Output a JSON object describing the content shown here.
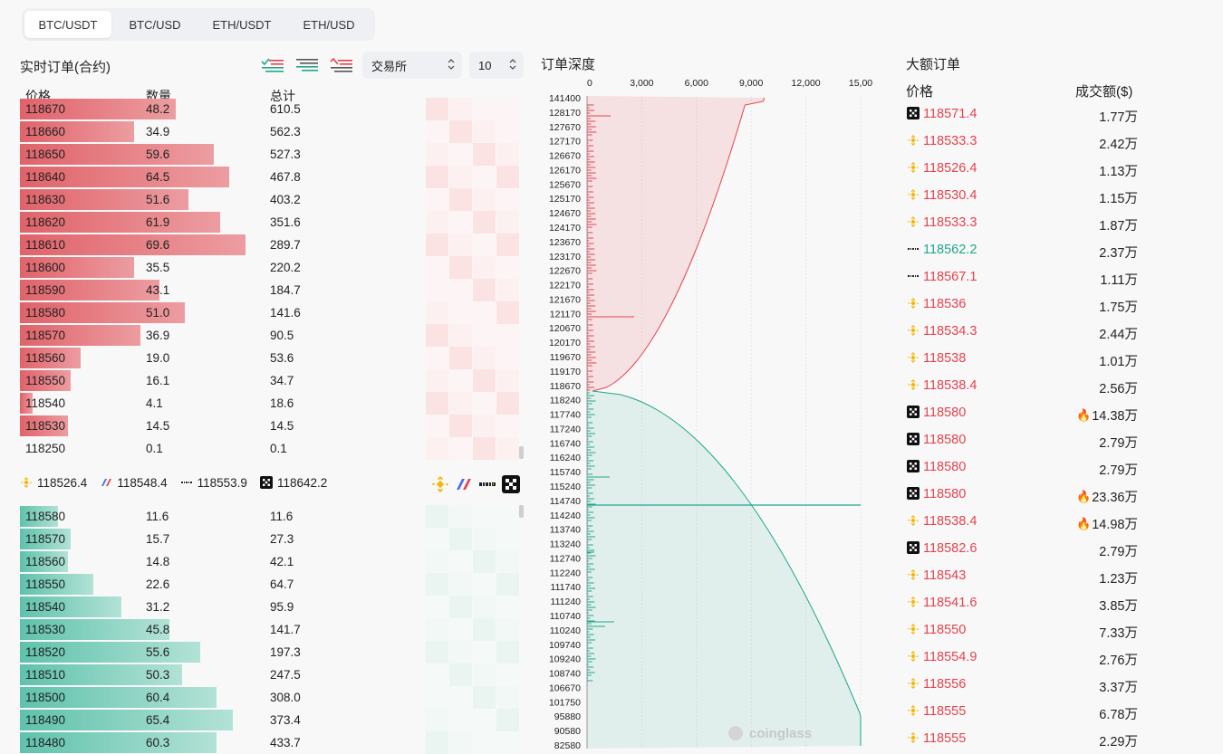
{
  "tabs": [
    "BTC/USDT",
    "BTC/USD",
    "ETH/USDT",
    "ETH/USD"
  ],
  "orderbook": {
    "title": "实时订单(合约)",
    "exchange_select": "交易所",
    "depth_select": "10",
    "headers": {
      "price": "价格",
      "qty": "数量",
      "total": "总计"
    },
    "asks": [
      {
        "price": "118670",
        "qty": "48.2",
        "total": "610.5",
        "fill": 0.49
      },
      {
        "price": "118660",
        "qty": "34.9",
        "total": "562.3",
        "fill": 0.36
      },
      {
        "price": "118650",
        "qty": "59.6",
        "total": "527.3",
        "fill": 0.61
      },
      {
        "price": "118640",
        "qty": "64.5",
        "total": "467.8",
        "fill": 0.66
      },
      {
        "price": "118630",
        "qty": "51.6",
        "total": "403.2",
        "fill": 0.53
      },
      {
        "price": "118620",
        "qty": "61.9",
        "total": "351.6",
        "fill": 0.63
      },
      {
        "price": "118610",
        "qty": "69.6",
        "total": "289.7",
        "fill": 0.71
      },
      {
        "price": "118600",
        "qty": "35.5",
        "total": "220.2",
        "fill": 0.36
      },
      {
        "price": "118590",
        "qty": "43.1",
        "total": "184.7",
        "fill": 0.44
      },
      {
        "price": "118580",
        "qty": "51.0",
        "total": "141.6",
        "fill": 0.52
      },
      {
        "price": "118570",
        "qty": "36.9",
        "total": "90.5",
        "fill": 0.38
      },
      {
        "price": "118560",
        "qty": "19.0",
        "total": "53.6",
        "fill": 0.19
      },
      {
        "price": "118550",
        "qty": "16.1",
        "total": "34.7",
        "fill": 0.16
      },
      {
        "price": "118540",
        "qty": "4.1",
        "total": "18.6",
        "fill": 0.04
      },
      {
        "price": "118530",
        "qty": "14.5",
        "total": "14.5",
        "fill": 0.15
      },
      {
        "price": "118250",
        "qty": "0.1",
        "total": "0.1",
        "fill": 0.0
      }
    ],
    "bids": [
      {
        "price": "118580",
        "qty": "11.6",
        "total": "11.6",
        "fill": 0.12
      },
      {
        "price": "118570",
        "qty": "15.7",
        "total": "27.3",
        "fill": 0.16
      },
      {
        "price": "118560",
        "qty": "14.8",
        "total": "42.1",
        "fill": 0.15
      },
      {
        "price": "118550",
        "qty": "22.6",
        "total": "64.7",
        "fill": 0.23
      },
      {
        "price": "118540",
        "qty": "31.2",
        "total": "95.9",
        "fill": 0.32
      },
      {
        "price": "118530",
        "qty": "45.8",
        "total": "141.7",
        "fill": 0.47
      },
      {
        "price": "118520",
        "qty": "55.6",
        "total": "197.3",
        "fill": 0.57
      },
      {
        "price": "118510",
        "qty": "50.3",
        "total": "247.5",
        "fill": 0.51
      },
      {
        "price": "118500",
        "qty": "60.4",
        "total": "308.0",
        "fill": 0.62
      },
      {
        "price": "118490",
        "qty": "65.4",
        "total": "373.4",
        "fill": 0.67
      },
      {
        "price": "118480",
        "qty": "60.3",
        "total": "433.7",
        "fill": 0.62
      }
    ],
    "exchange_prices": [
      {
        "exchange": "binance",
        "price": "118526.4"
      },
      {
        "exchange": "bitmex",
        "price": "118548.4"
      },
      {
        "exchange": "bybit",
        "price": "118553.9"
      },
      {
        "exchange": "okx",
        "price": "118642.2"
      }
    ]
  },
  "depth_chart": {
    "title": "订单深度",
    "x_ticks": [
      "0",
      "3,000",
      "6,000",
      "9,000",
      "12,000",
      "15,00"
    ],
    "y_ticks": [
      "141400",
      "128170",
      "127670",
      "127170",
      "126670",
      "126170",
      "125670",
      "125170",
      "124670",
      "124170",
      "123670",
      "123170",
      "122670",
      "122170",
      "121670",
      "121170",
      "120670",
      "120170",
      "119670",
      "119170",
      "118670",
      "118240",
      "117740",
      "117240",
      "116740",
      "116240",
      "115740",
      "115240",
      "114740",
      "114240",
      "113740",
      "113240",
      "112740",
      "112240",
      "111740",
      "111240",
      "110740",
      "110240",
      "109740",
      "109240",
      "108740",
      "106670",
      "101750",
      "95880",
      "90580",
      "82580"
    ],
    "watermark": "coinglass",
    "colors": {
      "ask": "#e5424e",
      "bid": "#1fa78a"
    }
  },
  "large_orders": {
    "title": "大额订单",
    "headers": {
      "price": "价格",
      "amount": "成交额($)"
    },
    "rows": [
      {
        "exchange": "okx",
        "price": "118571.4",
        "amount": "1.77万",
        "side": "sell",
        "hot": false
      },
      {
        "exchange": "binance",
        "price": "118533.3",
        "amount": "2.42万",
        "side": "sell",
        "hot": false
      },
      {
        "exchange": "binance",
        "price": "118526.4",
        "amount": "1.13万",
        "side": "sell",
        "hot": false
      },
      {
        "exchange": "binance",
        "price": "118530.4",
        "amount": "1.15万",
        "side": "sell",
        "hot": false
      },
      {
        "exchange": "binance",
        "price": "118533.3",
        "amount": "1.87万",
        "side": "sell",
        "hot": false
      },
      {
        "exchange": "bybit",
        "price": "118562.2",
        "amount": "2.37万",
        "side": "buy",
        "hot": false
      },
      {
        "exchange": "bybit",
        "price": "118567.1",
        "amount": "1.11万",
        "side": "sell",
        "hot": false
      },
      {
        "exchange": "binance",
        "price": "118536",
        "amount": "1.75万",
        "side": "sell",
        "hot": false
      },
      {
        "exchange": "binance",
        "price": "118534.3",
        "amount": "2.44万",
        "side": "sell",
        "hot": false
      },
      {
        "exchange": "binance",
        "price": "118538",
        "amount": "1.01万",
        "side": "sell",
        "hot": false
      },
      {
        "exchange": "binance",
        "price": "118538.4",
        "amount": "2.56万",
        "side": "sell",
        "hot": false
      },
      {
        "exchange": "okx",
        "price": "118580",
        "amount": "14.38万",
        "side": "sell",
        "hot": true
      },
      {
        "exchange": "okx",
        "price": "118580",
        "amount": "2.79万",
        "side": "sell",
        "hot": false
      },
      {
        "exchange": "okx",
        "price": "118580",
        "amount": "2.79万",
        "side": "sell",
        "hot": false
      },
      {
        "exchange": "okx",
        "price": "118580",
        "amount": "23.36万",
        "side": "sell",
        "hot": true
      },
      {
        "exchange": "binance",
        "price": "118538.4",
        "amount": "14.98万",
        "side": "sell",
        "hot": true
      },
      {
        "exchange": "okx",
        "price": "118582.6",
        "amount": "2.79万",
        "side": "sell",
        "hot": false
      },
      {
        "exchange": "binance",
        "price": "118543",
        "amount": "1.23万",
        "side": "sell",
        "hot": false
      },
      {
        "exchange": "binance",
        "price": "118541.6",
        "amount": "3.85万",
        "side": "sell",
        "hot": false
      },
      {
        "exchange": "binance",
        "price": "118550",
        "amount": "7.33万",
        "side": "sell",
        "hot": false
      },
      {
        "exchange": "binance",
        "price": "118554.9",
        "amount": "2.76万",
        "side": "sell",
        "hot": false
      },
      {
        "exchange": "binance",
        "price": "118556",
        "amount": "3.37万",
        "side": "sell",
        "hot": false
      },
      {
        "exchange": "binance",
        "price": "118555",
        "amount": "6.78万",
        "side": "sell",
        "hot": false
      },
      {
        "exchange": "binance",
        "price": "118555",
        "amount": "2.29万",
        "side": "sell",
        "hot": false
      }
    ]
  }
}
